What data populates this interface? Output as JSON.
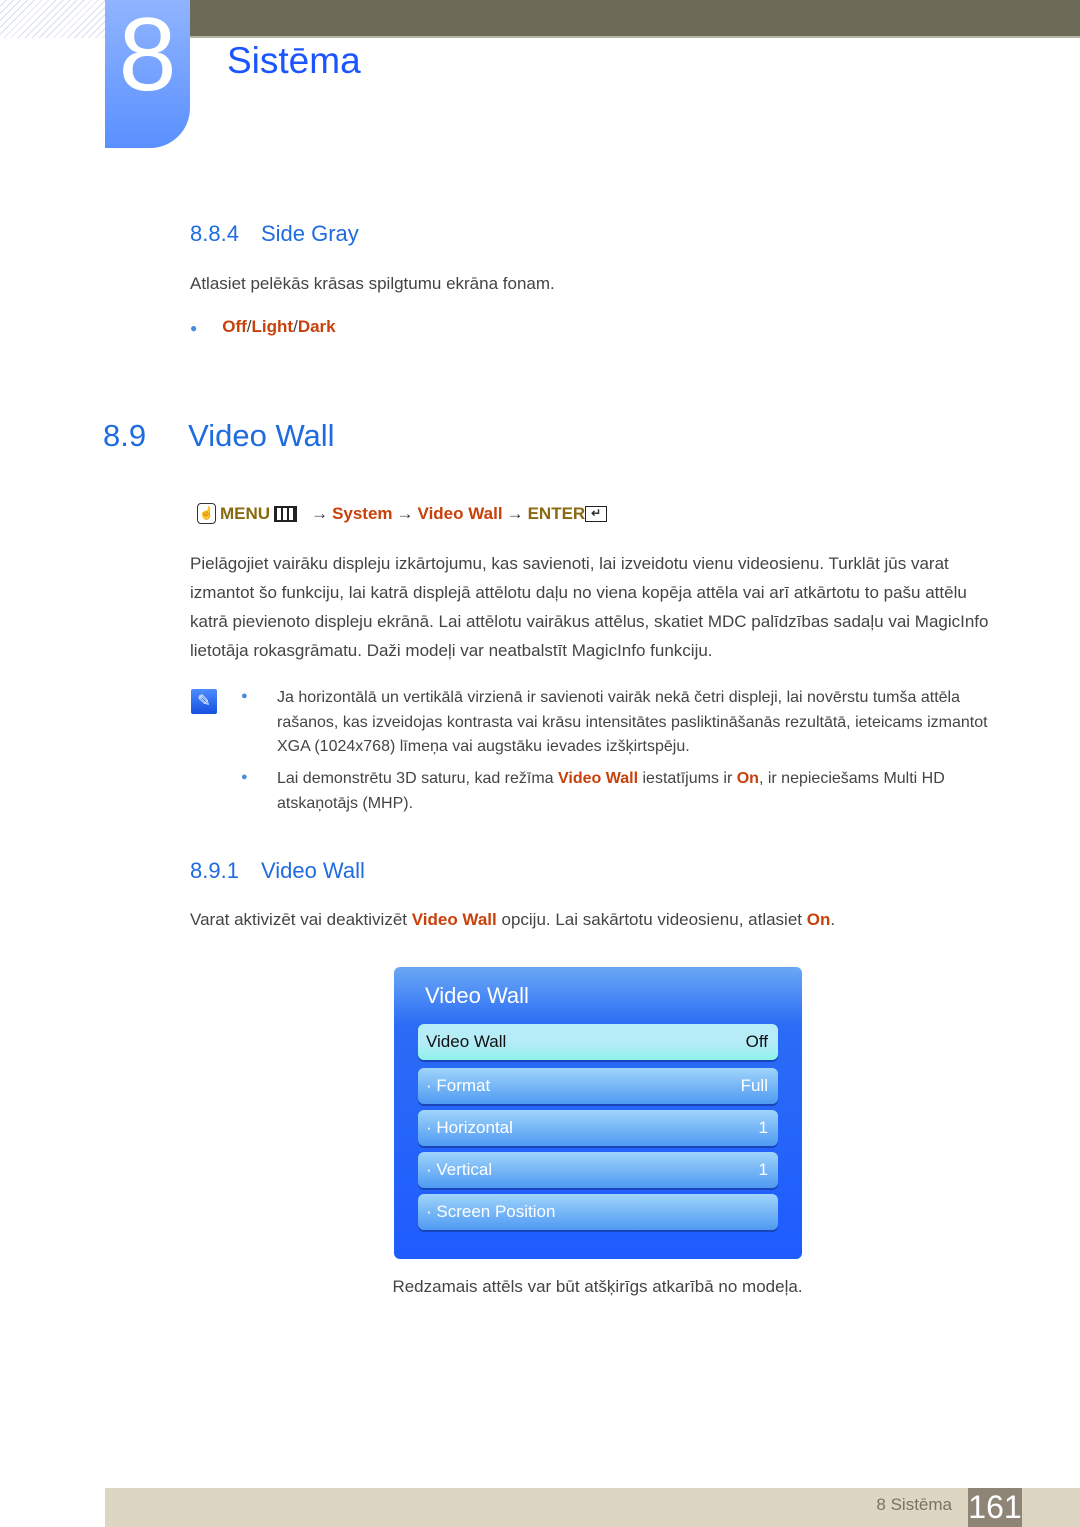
{
  "chapter": {
    "number": "8",
    "title": "Sistēma"
  },
  "s884": {
    "number": "8.8.4",
    "title": "Side Gray",
    "text": "Atlasiet pelēkās krāsas spilgtumu ekrāna fonam.",
    "options": [
      "Off",
      "Light",
      "Dark"
    ],
    "sep": "/"
  },
  "s89": {
    "number": "8.9",
    "title": "Video Wall",
    "path": {
      "menu": "MENU",
      "arrow": "→",
      "system": "System",
      "videowall": "Video Wall",
      "enter": "ENTER"
    },
    "para": "Pielāgojiet vairāku displeju izkārtojumu, kas savienoti, lai izveidotu vienu videosienu. Turklāt jūs varat izmantot šo funkciju, lai katrā displejā attēlotu daļu no viena kopēja attēla vai arī atkārtotu to pašu attēlu katrā pievienoto displeju ekrānā. Lai attēlotu vairākus attēlus, skatiet MDC palīdzības sadaļu vai MagicInfo lietotāja rokasgrāmatu. Daži modeļi var neatbalstīt MagicInfo funkciju.",
    "note1": "Ja horizontālā un vertikālā virzienā ir savienoti vairāk nekā četri displeji, lai novērstu tumša attēla rašanos, kas izveidojas kontrasta vai krāsu intensitātes pasliktināšanās rezultātā, ieteicams izmantot XGA (1024x768) līmeņa vai augstāku ievades izšķirtspēju.",
    "note2a": "Lai demonstrētu 3D saturu, kad režīma ",
    "note2b": "Video Wall",
    "note2c": " iestatījums ir ",
    "note2d": "On",
    "note2e": ", ir nepieciešams Multi HD atskaņotājs (MHP)."
  },
  "s891": {
    "number": "8.9.1",
    "title": "Video Wall",
    "t1": "Varat aktivizēt vai deaktivizēt ",
    "t2": "Video Wall",
    "t3": " opciju. Lai sakārtotu videosienu, atlasiet ",
    "t4": "On",
    "t5": "."
  },
  "menu": {
    "title": "Video Wall",
    "items": [
      {
        "label": "Video Wall",
        "value": "Off"
      },
      {
        "label": "· Format",
        "value": "Full"
      },
      {
        "label": "· Horizontal",
        "value": "1"
      },
      {
        "label": "· Vertical",
        "value": "1"
      },
      {
        "label": "· Screen Position",
        "value": ""
      }
    ]
  },
  "caption": "Redzamais attēls var būt atšķirīgs atkarībā no modeļa.",
  "footer": {
    "chapter": "8 Sistēma",
    "page": "161"
  }
}
